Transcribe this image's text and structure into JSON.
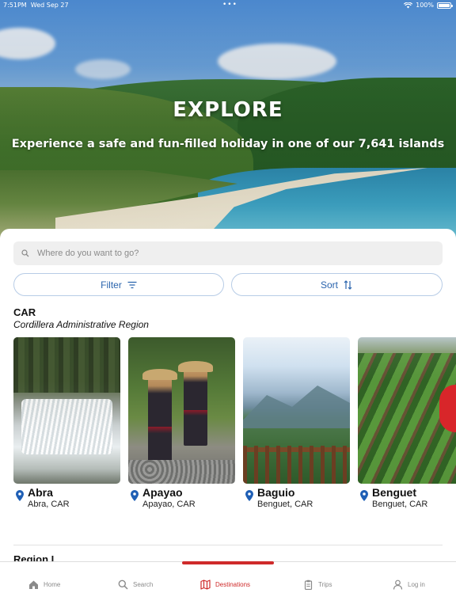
{
  "status_bar": {
    "time": "7:51PM",
    "date": "Wed Sep 27",
    "dots": "•••",
    "battery": "100%"
  },
  "hero": {
    "title": "EXPLORE",
    "subtitle": "Experience a safe and fun-filled holiday in one of our 7,641 islands"
  },
  "search": {
    "placeholder": "Where do you want to go?"
  },
  "filters": {
    "filter_label": "Filter",
    "sort_label": "Sort"
  },
  "region": {
    "code": "CAR",
    "name": "Cordillera Administrative Region",
    "destinations": [
      {
        "name": "Abra",
        "location": "Abra, CAR"
      },
      {
        "name": "Apayao",
        "location": "Apayao, CAR"
      },
      {
        "name": "Baguio",
        "location": "Benguet, CAR"
      },
      {
        "name": "Benguet",
        "location": "Benguet, CAR"
      }
    ]
  },
  "next_region": {
    "code": "Region I"
  },
  "tabbar": {
    "tabs": [
      {
        "label": "Home",
        "icon": "home-icon"
      },
      {
        "label": "Search",
        "icon": "search-icon"
      },
      {
        "label": "Destinations",
        "icon": "map-icon",
        "active": true
      },
      {
        "label": "Trips",
        "icon": "clipboard-icon"
      },
      {
        "label": "Log in",
        "icon": "user-icon"
      }
    ]
  },
  "colors": {
    "accent": "#cf2a2a",
    "link_blue": "#2a64ad",
    "pin_blue": "#1f5fb5"
  }
}
